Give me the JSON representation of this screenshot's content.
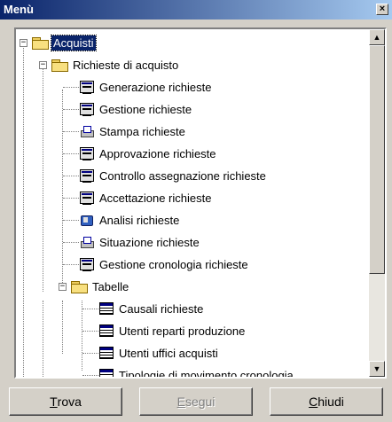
{
  "window": {
    "title": "Menù",
    "close_glyph": "×"
  },
  "tree": [
    {
      "label": "Acquisti",
      "icon": "folder-open-icon",
      "expander": "−",
      "selected": true
    },
    {
      "label": "Richieste di acquisto",
      "icon": "folder-open-icon",
      "expander": "−"
    },
    {
      "label": "Generazione richieste",
      "icon": "form-icon"
    },
    {
      "label": "Gestione richieste",
      "icon": "form-icon"
    },
    {
      "label": "Stampa richieste",
      "icon": "print-icon"
    },
    {
      "label": "Approvazione richieste",
      "icon": "form-icon"
    },
    {
      "label": "Controllo assegnazione richieste",
      "icon": "form-icon"
    },
    {
      "label": "Accettazione richieste",
      "icon": "form-icon"
    },
    {
      "label": "Analisi richieste",
      "icon": "analysis-icon"
    },
    {
      "label": "Situazione richieste",
      "icon": "print-icon"
    },
    {
      "label": "Gestione cronologia richieste",
      "icon": "form-icon"
    },
    {
      "label": "Tabelle",
      "icon": "folder-open-icon",
      "expander": "−"
    },
    {
      "label": "Causali richieste",
      "icon": "table-icon"
    },
    {
      "label": "Utenti reparti produzione",
      "icon": "table-icon"
    },
    {
      "label": "Utenti uffici acquisti",
      "icon": "table-icon"
    },
    {
      "label": "Tipologie di movimento cronologia",
      "icon": "table-icon"
    }
  ],
  "scrollbar": {
    "up_glyph": "▲",
    "down_glyph": "▼"
  },
  "buttons": {
    "find": {
      "accel": "T",
      "rest": "rova"
    },
    "run": {
      "accel": "E",
      "rest": "segui",
      "disabled": true
    },
    "close": {
      "accel": "C",
      "rest": "hiudi"
    }
  }
}
